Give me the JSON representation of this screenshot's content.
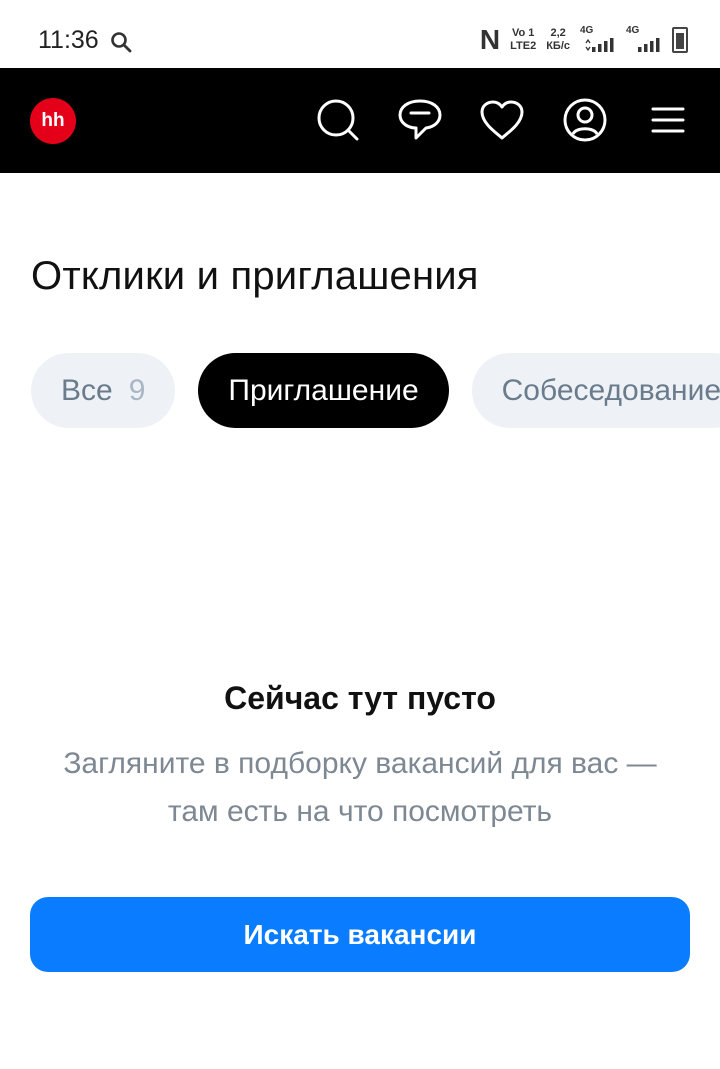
{
  "status_bar": {
    "time": "11:36",
    "nfc": "N",
    "volte_top": "Vo 1",
    "volte_bottom": "LTE2",
    "speed_value": "2,2",
    "speed_unit": "КБ/с",
    "signal1_label": "4G",
    "signal2_label": "4G"
  },
  "header": {
    "logo_text": "hh",
    "icons": [
      "search-icon",
      "chat-icon",
      "heart-icon",
      "profile-icon",
      "menu-icon"
    ]
  },
  "page": {
    "title": "Отклики и приглашения"
  },
  "filters": [
    {
      "label": "Все",
      "count": "9",
      "active": false
    },
    {
      "label": "Приглашение",
      "count": "",
      "active": true
    },
    {
      "label": "Собеседование",
      "count": "",
      "active": false
    }
  ],
  "empty_state": {
    "title": "Сейчас тут пусто",
    "text_line1": "Загляните в подборку вакансий для вас —",
    "text_line2": "там есть на что посмотреть",
    "button_label": "Искать вакансии"
  },
  "colors": {
    "header_bg": "#000000",
    "logo_red": "#e5001a",
    "primary_blue": "#0a7cff",
    "chip_inactive_bg": "#eef2f7"
  }
}
